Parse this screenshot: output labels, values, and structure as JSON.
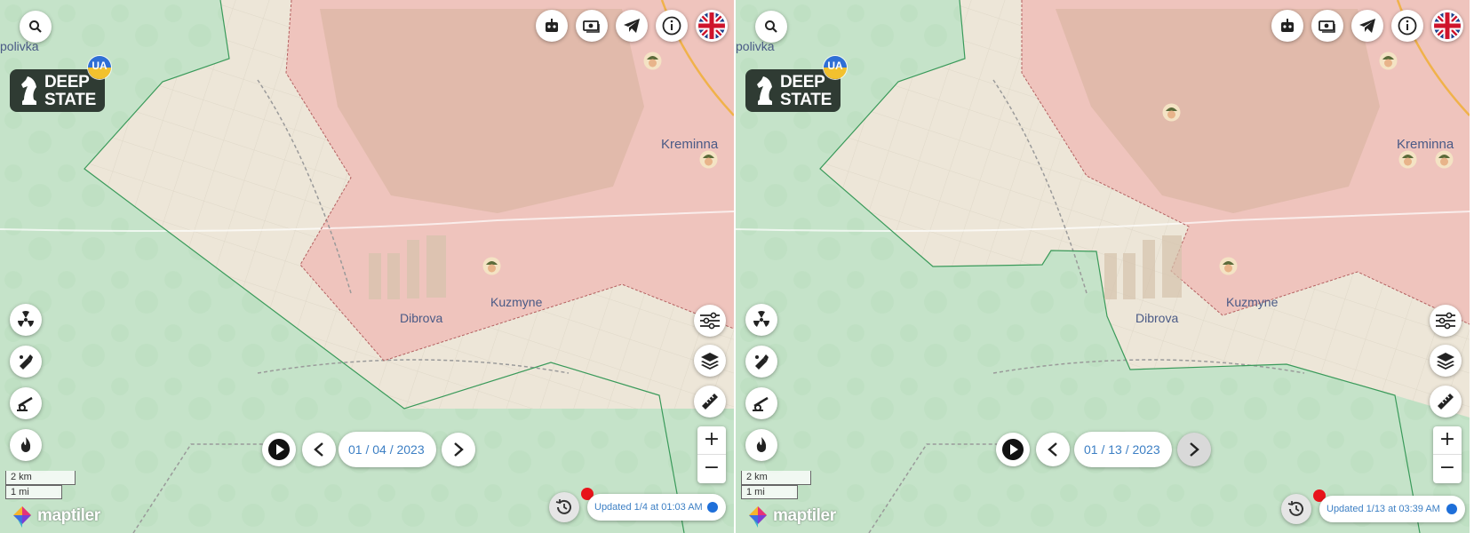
{
  "colors": {
    "ukraine_controlled": "#c5e3c9",
    "russian_occupied": "#efc4bd",
    "liberated_or_contested": "#ede6d8",
    "front_line_green": "#3a9a5a",
    "front_line_red": "#b46060",
    "accent_blue": "#3c7fc4",
    "updated_dot": "#1e6fd9",
    "notification_red": "#e8141a",
    "logo_bg": "#2f3b33"
  },
  "panels": [
    {
      "date_value": "01 / 04 / 2023",
      "updated_text": "Updated 1/4 at 01:03 AM",
      "places": [
        "Kreminna",
        "Dibrova",
        "Kuzmyne",
        "polivka"
      ],
      "russian_unit_markers": 3,
      "next_button_state": "enabled"
    },
    {
      "date_value": "01 / 13 / 2023",
      "updated_text": "Updated 1/13 at 03:39 AM",
      "places": [
        "Kreminna",
        "Dibrova",
        "Kuzmyne",
        "polivka"
      ],
      "russian_unit_markers": 5,
      "next_button_state": "disabled"
    }
  ],
  "logo": {
    "line1": "DEEP",
    "line2": "STATE",
    "badge": "UA"
  },
  "scale": {
    "metric": "2 km",
    "imperial": "1 mi"
  },
  "attribution": "maptiler",
  "toolbar_top": {
    "icons": [
      "search-icon",
      "robot-icon",
      "money-icon",
      "telegram-icon",
      "info-icon",
      "uk-flag-icon"
    ]
  },
  "toolbar_left": {
    "icons": [
      "radiation-icon",
      "shell-icon",
      "artillery-icon",
      "fire-icon"
    ]
  },
  "toolbar_right": {
    "icons": [
      "filters-icon",
      "layers-icon",
      "ruler-icon"
    ],
    "zoom_in": "+",
    "zoom_out": "−"
  }
}
